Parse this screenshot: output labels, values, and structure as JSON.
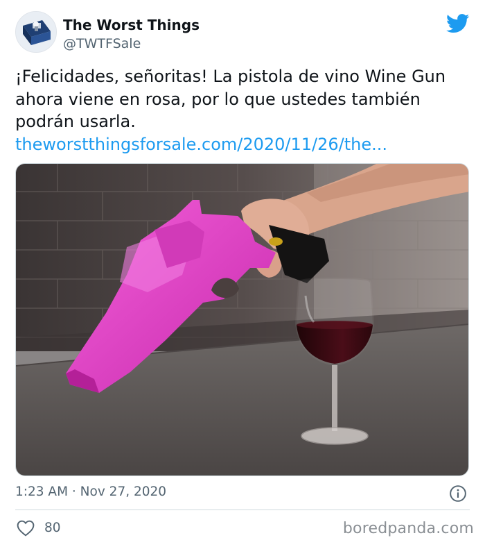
{
  "tweet": {
    "author_name": "The Worst Things",
    "author_handle": "@TWTFSale",
    "text_lines": [
      "¡Felicidades, señoritas! La pistola de vino Wine Gun",
      "ahora viene en rosa, por lo que ustedes también",
      "podrán usarla."
    ],
    "link": "theworstthingsforsale.com/2020/11/26/the...",
    "timestamp": "1:23 AM · Nov 27, 2020",
    "like_count": "80"
  },
  "media": {
    "description_icon": "pink-wine-gun-photo"
  },
  "watermark": "boredpanda.com",
  "colors": {
    "twitter_blue": "#1d9bf0",
    "text_primary": "#0f1419",
    "text_secondary": "#536471",
    "gun_pink": "#e13fc7",
    "wine_red": "#3b0a12"
  }
}
